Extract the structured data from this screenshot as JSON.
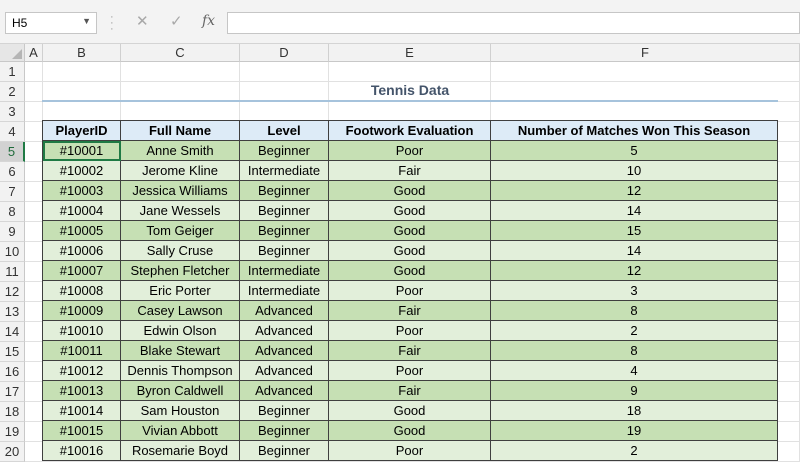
{
  "formula_bar": {
    "name_box": "H5",
    "cancel_icon": "✕",
    "enter_icon": "✓",
    "fx_label": "fx",
    "formula": ""
  },
  "columns": [
    "A",
    "B",
    "C",
    "D",
    "E",
    "F"
  ],
  "rows": [
    "1",
    "2",
    "3",
    "4",
    "5",
    "6",
    "7",
    "8",
    "9",
    "10",
    "11",
    "12",
    "13",
    "14",
    "15",
    "16",
    "17",
    "18",
    "19",
    "20"
  ],
  "active_row": "5",
  "title": "Tennis Data",
  "table": {
    "headers": [
      "PlayerID",
      "Full Name",
      "Level",
      "Footwork Evaluation",
      "Number of Matches Won This Season"
    ],
    "rows": [
      [
        "#10001",
        "Anne Smith",
        "Beginner",
        "Poor",
        "5"
      ],
      [
        "#10002",
        "Jerome Kline",
        "Intermediate",
        "Fair",
        "10"
      ],
      [
        "#10003",
        "Jessica Williams",
        "Beginner",
        "Good",
        "12"
      ],
      [
        "#10004",
        "Jane Wessels",
        "Beginner",
        "Good",
        "14"
      ],
      [
        "#10005",
        "Tom Geiger",
        "Beginner",
        "Good",
        "15"
      ],
      [
        "#10006",
        "Sally Cruse",
        "Beginner",
        "Good",
        "14"
      ],
      [
        "#10007",
        "Stephen Fletcher",
        "Intermediate",
        "Good",
        "12"
      ],
      [
        "#10008",
        "Eric Porter",
        "Intermediate",
        "Poor",
        "3"
      ],
      [
        "#10009",
        "Casey Lawson",
        "Advanced",
        "Fair",
        "8"
      ],
      [
        "#10010",
        "Edwin Olson",
        "Advanced",
        "Poor",
        "2"
      ],
      [
        "#10011",
        "Blake Stewart",
        "Advanced",
        "Fair",
        "8"
      ],
      [
        "#10012",
        "Dennis Thompson",
        "Advanced",
        "Poor",
        "4"
      ],
      [
        "#10013",
        "Byron Caldwell",
        "Advanced",
        "Fair",
        "9"
      ],
      [
        "#10014",
        "Sam Houston",
        "Beginner",
        "Good",
        "18"
      ],
      [
        "#10015",
        "Vivian Abbott",
        "Beginner",
        "Good",
        "19"
      ],
      [
        "#10016",
        "Rosemarie Boyd",
        "Beginner",
        "Poor",
        "2"
      ]
    ]
  },
  "colors": {
    "header_fill": "#ddebf7",
    "band_dark": "#c6e0b4",
    "band_light": "#e2efda",
    "title_text": "#44546a",
    "selection": "#1f7a44"
  }
}
